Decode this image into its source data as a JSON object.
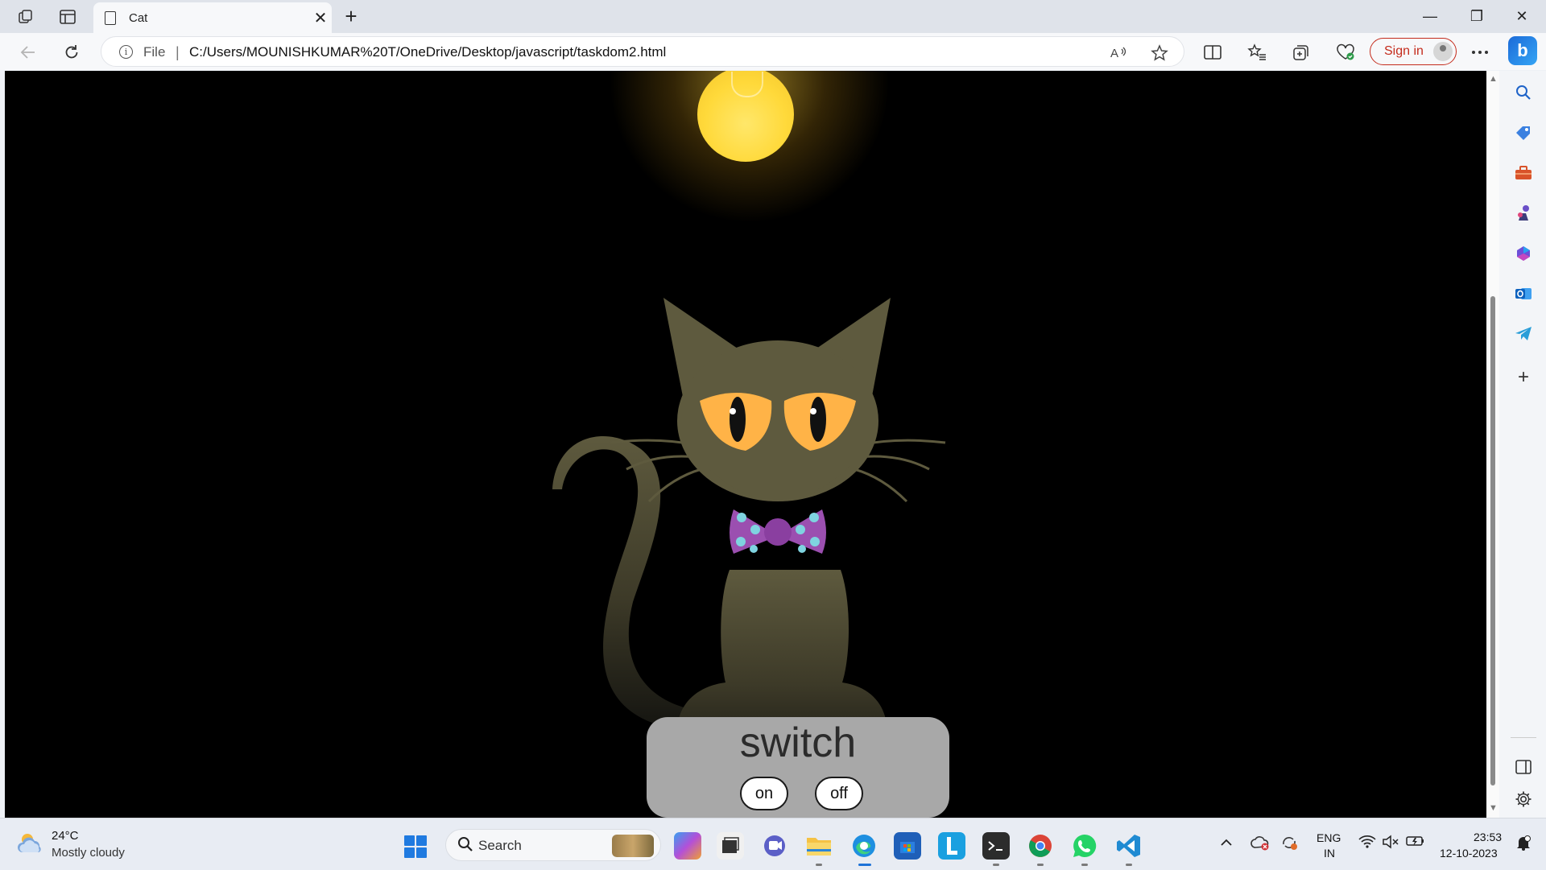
{
  "browser": {
    "tab": {
      "title": "Cat",
      "close": "✕"
    },
    "new_tab": "+",
    "window_controls": {
      "minimize": "—",
      "maximize": "❐",
      "close": "✕"
    },
    "address": {
      "scheme": "File",
      "separator": "|",
      "url": "C:/Users/MOUNISHKUMAR%20T/OneDrive/Desktop/javascript/taskdom2.html"
    },
    "sign_in": "Sign in",
    "copilot": "b",
    "icons": [
      "workspaces-icon",
      "tab-actions-icon",
      "back-icon",
      "refresh-icon",
      "read-aloud-icon",
      "favorite-star-icon",
      "split-screen-icon",
      "favorites-icon",
      "collections-icon",
      "browser-essentials-icon",
      "more-icon"
    ]
  },
  "page": {
    "switch_title": "switch",
    "on_label": "on",
    "off_label": "off",
    "colors": {
      "background": "#000000",
      "cat": "#5e5a3e",
      "eyes": "#ffb347",
      "bowtie": "#9b4fb0",
      "bowtie_dots": "#7fd3e0",
      "bulb": "#ffd93a",
      "panel": "#a8a8a8"
    }
  },
  "sidebar": {
    "icons": [
      "search-icon",
      "shopping-icon",
      "tools-icon",
      "games-icon",
      "microsoft365-icon",
      "outlook-icon",
      "telegram-icon",
      "add-icon",
      "sidebar-toggle-icon",
      "settings-icon"
    ],
    "add": "+"
  },
  "taskbar": {
    "weather": {
      "temp": "24°C",
      "desc": "Mostly cloudy"
    },
    "search_label": "Search",
    "apps": [
      "copilot-preview",
      "files",
      "teams",
      "file-explorer",
      "edge",
      "store",
      "l-app",
      "terminal",
      "chrome",
      "whatsapp",
      "vscode"
    ],
    "lang_line1": "ENG",
    "lang_line2": "IN",
    "time": "23:53",
    "date": "12-10-2023"
  }
}
